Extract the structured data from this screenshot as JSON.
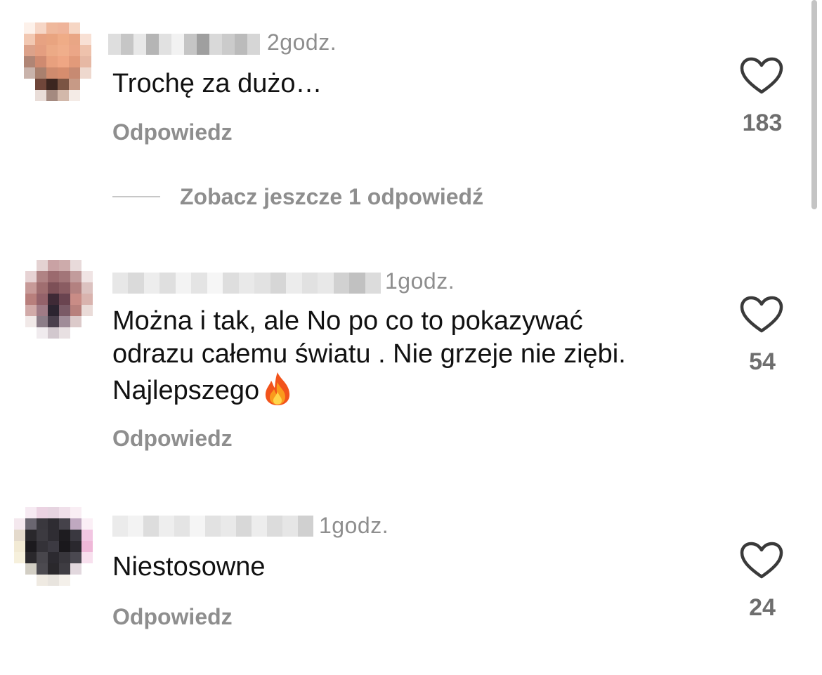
{
  "comments": [
    {
      "time": "2godz.",
      "text": "Trochę za dużo…",
      "reply_label": "Odpowiedz",
      "likes": "183"
    },
    {
      "time": "1godz.",
      "text_line1": "Można i tak, ale No po co to pokazywać",
      "text_line2": "odrazu całemu światu . Nie grzeje nie ziębi.",
      "text_line3": "Najlepszego",
      "emoji": "fire-emoji",
      "reply_label": "Odpowiedz",
      "likes": "54"
    },
    {
      "time": "1godz.",
      "text": "Niestosowne",
      "reply_label": "Odpowiedz",
      "likes": "24"
    }
  ],
  "thread": {
    "more_replies_label": "Zobacz jeszcze 1 odpowiedź"
  },
  "icons": {
    "like": "heart-outline-icon",
    "emoji": "fire-emoji"
  },
  "colors": {
    "secondary_text": "#8e8e8e",
    "primary_text": "#111111",
    "count_text": "#6e6e6e"
  }
}
